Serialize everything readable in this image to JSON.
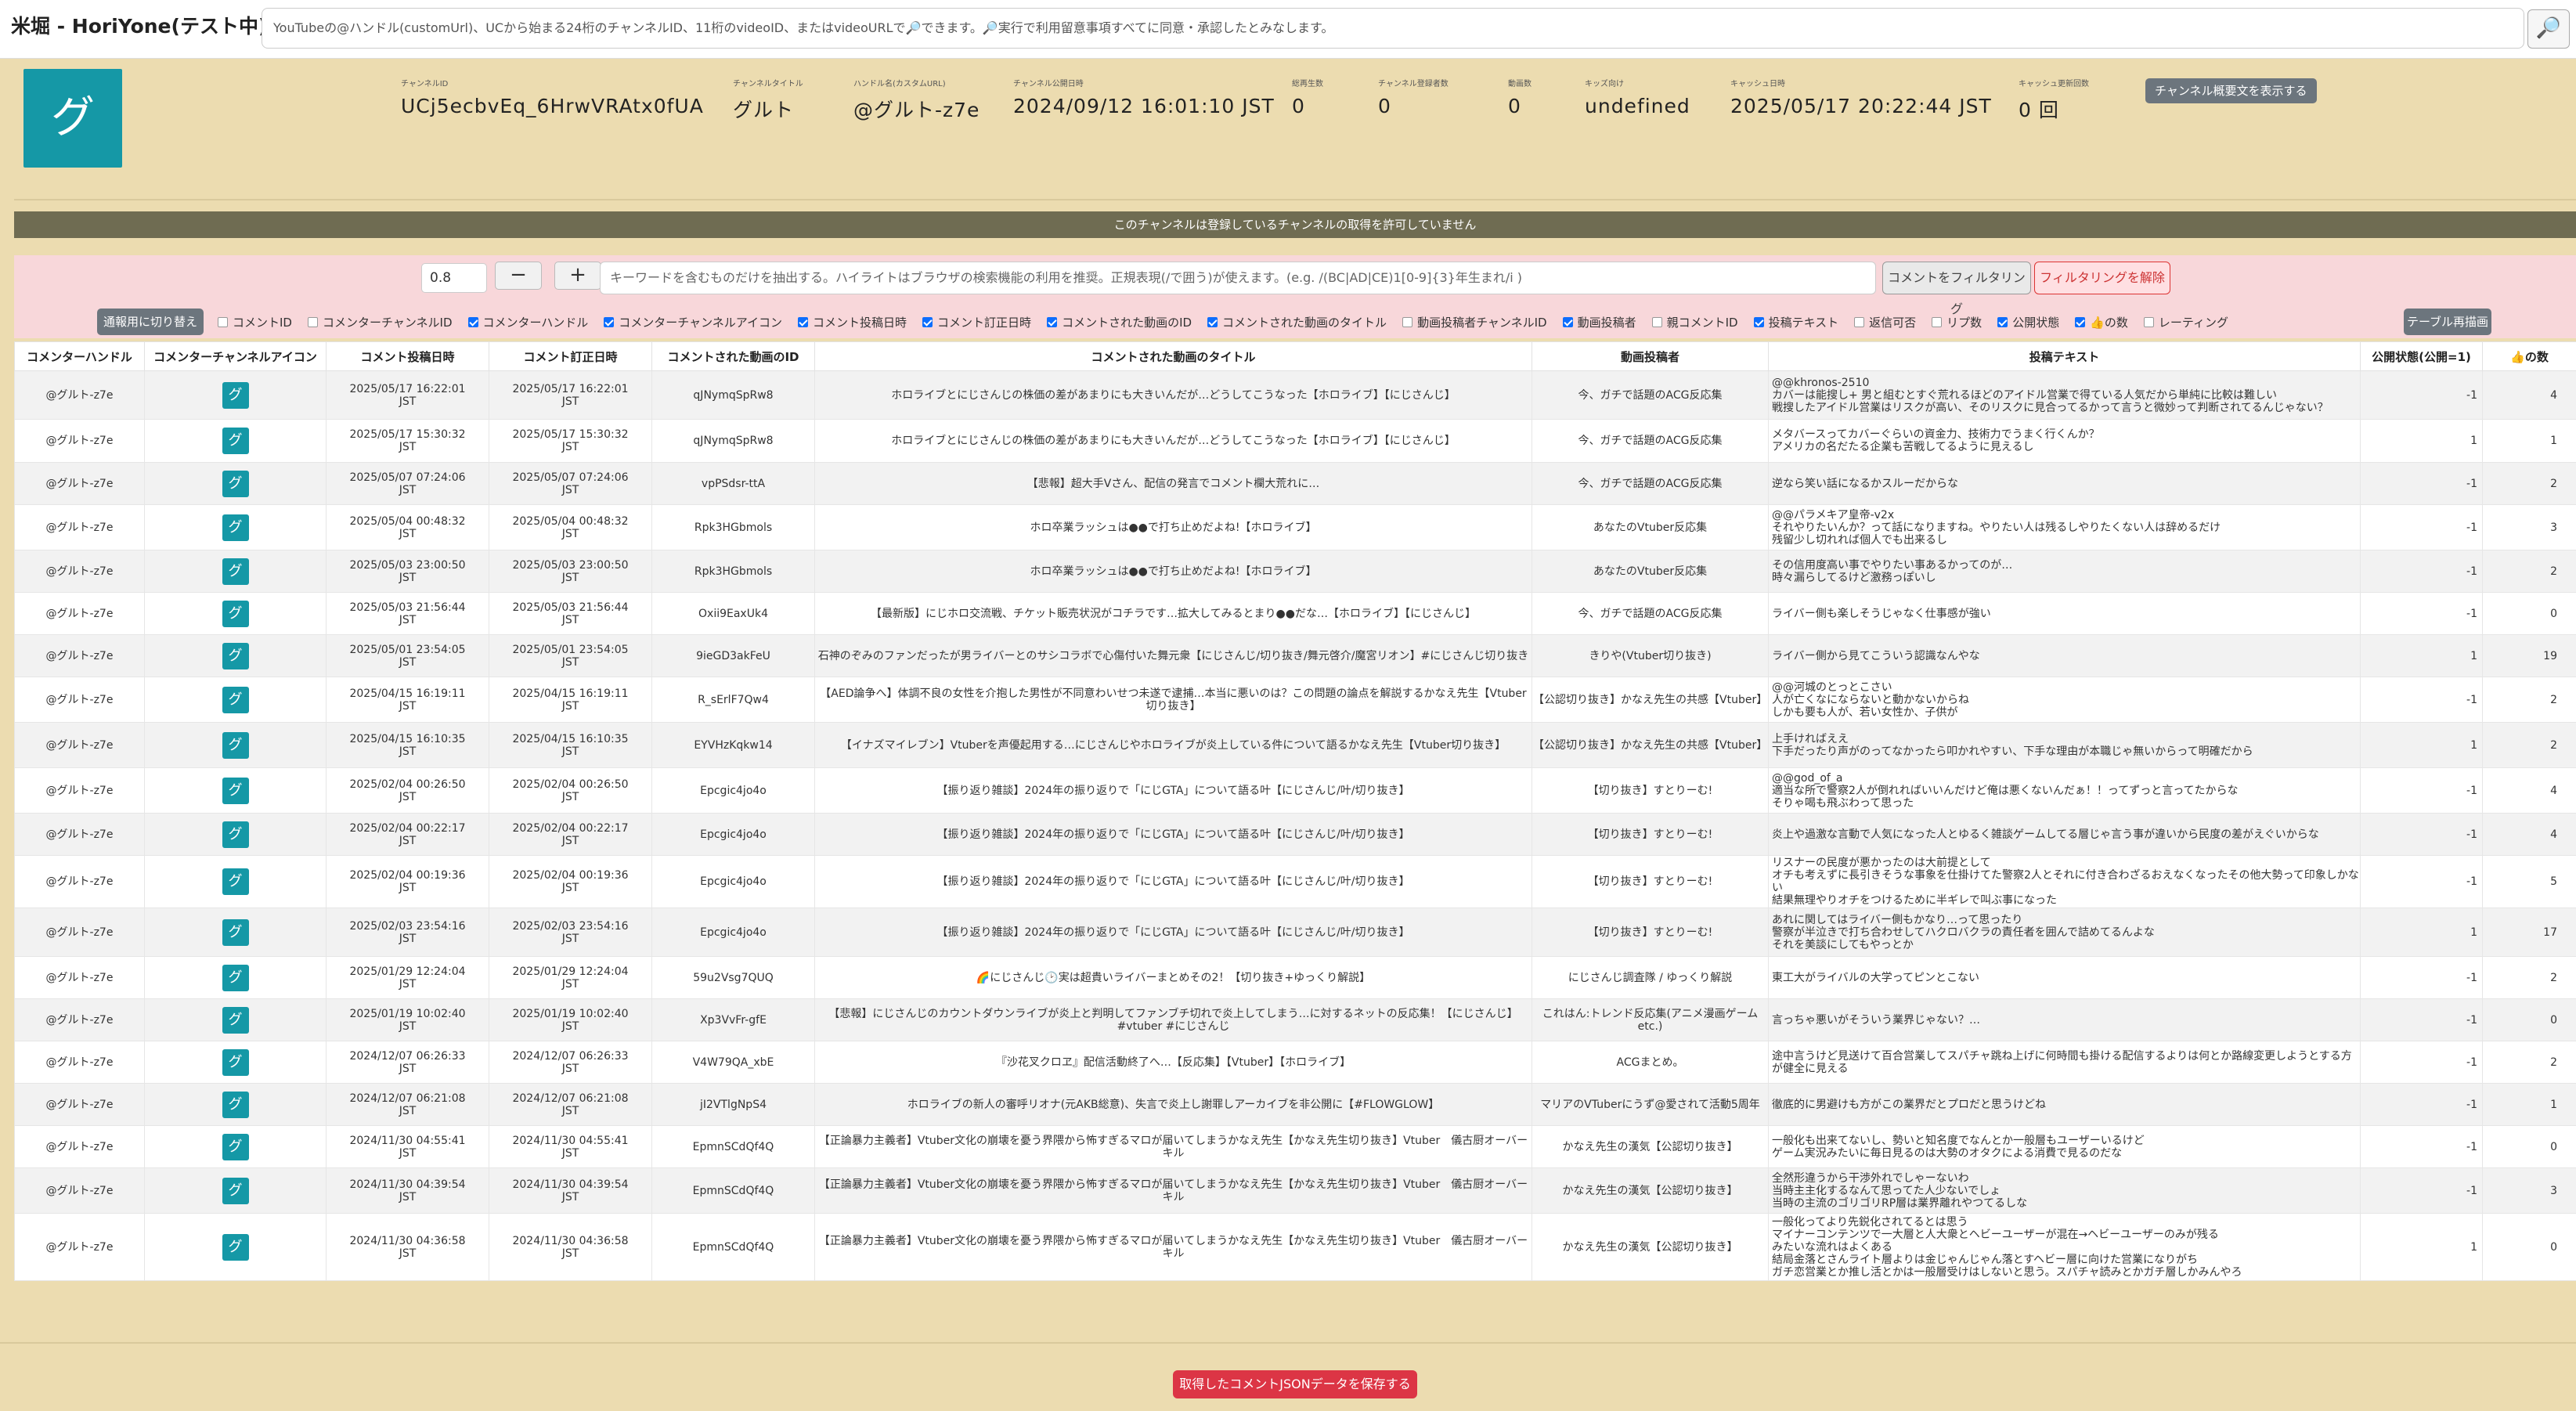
{
  "app": {
    "title": "米堀 - HoriYone(テスト中)"
  },
  "search": {
    "placeholder": "YouTubeの@ハンドル(customUrl)、UCから始まる24桁のチャンネルID、11桁のvideoID、またはvideoURLで🔎できます。🔎実行で利用留意事項すべてに同意・承認したとみなします。",
    "button_icon": "🔎"
  },
  "channel": {
    "icon_char": "グ",
    "fields": [
      {
        "label": "チャンネルID",
        "value": "UCj5ecbvEq_6HrwVRAtx0fUA"
      },
      {
        "label": "チャンネルタイトル",
        "value": "グルト"
      },
      {
        "label": "ハンドル名(カスタムURL)",
        "value": "@グルト-z7e"
      },
      {
        "label": "チャンネル公開日時",
        "value": "2024/09/12 16:01:10 JST"
      },
      {
        "label": "総再生数",
        "value": "0"
      },
      {
        "label": "チャンネル登録者数",
        "value": "0"
      },
      {
        "label": "動画数",
        "value": "0"
      },
      {
        "label": "キッズ向け",
        "value": "undefined"
      },
      {
        "label": "キャッシュ日時",
        "value": "2025/05/17 20:22:44 JST"
      },
      {
        "label": "キャッシュ更新回数",
        "value": "0 回"
      }
    ],
    "desc_button": "チャンネル概要文を表示する"
  },
  "banner": "このチャンネルは登録しているチャンネルの取得を許可していません",
  "filter": {
    "threshold": "0.8",
    "minus": "−",
    "plus": "+",
    "keyword_placeholder": "キーワードを含むものだけを抽出する。ハイライトはブラウザの検索機能の利用を推奨。正規表現(/で囲う)が使えます。(e.g. /(BC|AD|CE)1[0-9]{3}年生まれ/i )",
    "filter_button": "コメントをフィルタリング",
    "unfilter_button": "フィルタリングを解除",
    "switch_button": "通報用に切り替え",
    "redraw_button": "テーブル再描画",
    "columns": [
      {
        "label": "コメントID",
        "checked": false
      },
      {
        "label": "コメンターチャンネルID",
        "checked": false
      },
      {
        "label": "コメンターハンドル",
        "checked": true
      },
      {
        "label": "コメンターチャンネルアイコン",
        "checked": true
      },
      {
        "label": "コメント投稿日時",
        "checked": true
      },
      {
        "label": "コメント訂正日時",
        "checked": true
      },
      {
        "label": "コメントされた動画のID",
        "checked": true
      },
      {
        "label": "コメントされた動画のタイトル",
        "checked": true
      },
      {
        "label": "動画投稿者チャンネルID",
        "checked": false
      },
      {
        "label": "動画投稿者",
        "checked": true
      },
      {
        "label": "親コメントID",
        "checked": false
      },
      {
        "label": "投稿テキスト",
        "checked": true
      },
      {
        "label": "返信可否",
        "checked": false
      },
      {
        "label": "リプ数",
        "checked": false
      },
      {
        "label": "公開状態",
        "checked": true
      },
      {
        "label": "👍の数",
        "checked": true
      },
      {
        "label": "レーティング",
        "checked": false
      }
    ]
  },
  "table": {
    "headers": [
      "コメンターハンドル",
      "コメンターチャンネルアイコン",
      "コメント投稿日時",
      "コメント訂正日時",
      "コメントされた動画のID",
      "コメントされた動画のタイトル",
      "動画投稿者",
      "投稿テキスト",
      "公開状態(公開=1)",
      "👍の数"
    ],
    "rows": [
      {
        "handle": "@グルト-z7e",
        "icon": "グ",
        "posted": "2025/05/17 16:22:01\nJST",
        "edited": "2025/05/17 16:22:01\nJST",
        "vid": "qJNymqSpRw8",
        "title": "ホロライブとにじさんじの株価の差があまりにも大きいんだが…どうしてこうなった【ホロライブ】【にじさんじ】",
        "uploader": "今、ガチで話題のACG反応集",
        "text": "@@khronos-2510\nカバーは能搜し+ 男と組むとすぐ荒れるほどのアイドル営業で得ている人気だから単純に比較は難しい\n戦搜したアイドル営業はリスクが高い、そのリスクに見合ってるかって言うと微妙って判断されてるんじゃない？",
        "status": "-1",
        "likes": "4",
        "h": 62
      },
      {
        "handle": "@グルト-z7e",
        "icon": "グ",
        "posted": "2025/05/17 15:30:32\nJST",
        "edited": "2025/05/17 15:30:32\nJST",
        "vid": "qJNymqSpRw8",
        "title": "ホロライブとにじさんじの株価の差があまりにも大きいんだが…どうしてこうなった【ホロライブ】【にじさんじ】",
        "uploader": "今、ガチで話題のACG反応集",
        "text": "メタバースってカバーぐらいの資金力、技術力でうまく行くんか？\nアメリカの名だたる企業も苦戦してるように見えるし",
        "status": "1",
        "likes": "1",
        "h": 55
      },
      {
        "handle": "@グルト-z7e",
        "icon": "グ",
        "posted": "2025/05/07 07:24:06\nJST",
        "edited": "2025/05/07 07:24:06\nJST",
        "vid": "vpPSdsr-ttA",
        "title": "【悲報】超大手Vさん、配信の発言でコメント欄大荒れに…",
        "uploader": "今、ガチで話題のACG反応集",
        "text": "逆なら笑い話になるかスルーだからな",
        "status": "-1",
        "likes": "2",
        "h": 54
      },
      {
        "handle": "@グルト-z7e",
        "icon": "グ",
        "posted": "2025/05/04 00:48:32\nJST",
        "edited": "2025/05/04 00:48:32\nJST",
        "vid": "Rpk3HGbmols",
        "title": "ホロ卒業ラッシュは●●で打ち止めだよね!【ホロライブ】",
        "uploader": "あなたのVtuber反応集",
        "text": "@@パラメキア皇帝-v2x\nそれやりたいんか？って話になりますね。やりたい人は残るしやりたくない人は辞めるだけ\n残留少し切れれば個人でも出来るし",
        "status": "-1",
        "likes": "3",
        "h": 58
      },
      {
        "handle": "@グルト-z7e",
        "icon": "グ",
        "posted": "2025/05/03 23:00:50\nJST",
        "edited": "2025/05/03 23:00:50\nJST",
        "vid": "Rpk3HGbmols",
        "title": "ホロ卒業ラッシュは●●で打ち止めだよね!【ホロライブ】",
        "uploader": "あなたのVtuber反応集",
        "text": "その信用度高い事でやりたい事あるかってのが…\n時々漏らしてるけど激務っぽいし",
        "status": "-1",
        "likes": "2",
        "h": 54
      },
      {
        "handle": "@グルト-z7e",
        "icon": "グ",
        "posted": "2025/05/03 21:56:44\nJST",
        "edited": "2025/05/03 21:56:44\nJST",
        "vid": "Oxii9EaxUk4",
        "title": "【最新版】にじホロ交流戦、チケット販売状況がコチラです…拡大してみるとまり●●だな…【ホロライブ】【にじさんじ】",
        "uploader": "今、ガチで話題のACG反応集",
        "text": "ライバー側も楽しそうじゃなく仕事感が強い",
        "status": "-1",
        "likes": "0",
        "h": 54
      },
      {
        "handle": "@グルト-z7e",
        "icon": "グ",
        "posted": "2025/05/01 23:54:05\nJST",
        "edited": "2025/05/01 23:54:05\nJST",
        "vid": "9ieGD3akFeU",
        "title": "石神のぞみのファンだったが男ライバーとのサシコラボで心傷付いた舞元衆【にじさんじ/切り抜き/舞元啓介/魔宮リオン】#にじさんじ切り抜き",
        "uploader": "きりや(Vtuber切り抜き)",
        "text": "ライバー側から見てこういう認識なんやな",
        "status": "1",
        "likes": "19",
        "h": 54
      },
      {
        "handle": "@グルト-z7e",
        "icon": "グ",
        "posted": "2025/04/15 16:19:11\nJST",
        "edited": "2025/04/15 16:19:11\nJST",
        "vid": "R_sErlF7Qw4",
        "title": "【AED論争へ】体調不良の女性を介抱した男性が不同意わいせつ未遂で逮捕…本当に悪いのは？この問題の論点を解説するかなえ先生【Vtuber切り抜き】",
        "uploader": "【公認切り抜き】かなえ先生の共感【Vtuber】",
        "text": "@@河城のとっとこさい\n人が亡くなにならないと動かないからね\nしかも要も人が、若い女性か、子供が",
        "status": "-1",
        "likes": "2",
        "h": 58
      },
      {
        "handle": "@グルト-z7e",
        "icon": "グ",
        "posted": "2025/04/15 16:10:35\nJST",
        "edited": "2025/04/15 16:10:35\nJST",
        "vid": "EYVHzKqkw14",
        "title": "【イナズマイレブン】Vtuberを声優起用する…にじさんじやホロライブが炎上している件について語るかなえ先生【Vtuber切り抜き】",
        "uploader": "【公認切り抜き】かなえ先生の共感【Vtuber】",
        "text": "上手ければええ\n下手だったり声がのってなかったら叩かれやすい、下手な理由が本職じゃ無いからって明確だから",
        "status": "1",
        "likes": "2",
        "h": 58
      },
      {
        "handle": "@グルト-z7e",
        "icon": "グ",
        "posted": "2025/02/04 00:26:50\nJST",
        "edited": "2025/02/04 00:26:50\nJST",
        "vid": "Epcgic4jo4o",
        "title": "【振り返り雑談】2024年の振り返りで「にじGTA」について語る叶【にじさんじ/叶/切り抜き】",
        "uploader": "【切り抜き】すとりーむ!",
        "text": "@@god_of_a\n適当な所で警察2人が倒れればいいんだけど俺は悪くないんだぁ！！ってずっと言ってたからな\nそりゃ喝も飛ぶわって思った",
        "status": "-1",
        "likes": "4",
        "h": 58
      },
      {
        "handle": "@グルト-z7e",
        "icon": "グ",
        "posted": "2025/02/04 00:22:17\nJST",
        "edited": "2025/02/04 00:22:17\nJST",
        "vid": "Epcgic4jo4o",
        "title": "【振り返り雑談】2024年の振り返りで「にじGTA」について語る叶【にじさんじ/叶/切り抜き】",
        "uploader": "【切り抜き】すとりーむ!",
        "text": "炎上や過激な言動で人気になった人とゆるく雑談ゲームしてる層じゃ言う事が違いから民度の差がえぐいからな",
        "status": "-1",
        "likes": "4",
        "h": 54
      },
      {
        "handle": "@グルト-z7e",
        "icon": "グ",
        "posted": "2025/02/04 00:19:36\nJST",
        "edited": "2025/02/04 00:19:36\nJST",
        "vid": "Epcgic4jo4o",
        "title": "【振り返り雑談】2024年の振り返りで「にじGTA」について語る叶【にじさんじ/叶/切り抜き】",
        "uploader": "【切り抜き】すとりーむ!",
        "text": "リスナーの民度が悪かったのは大前提として\nオチも考えずに長引きそうな事象を仕掛けてた警察2人とそれに付き合わざるおえなくなったその他大勢って印象しかない\n結果無理やりオチをつけるために半ギレで叫ぶ事になった",
        "status": "-1",
        "likes": "5",
        "h": 58
      },
      {
        "handle": "@グルト-z7e",
        "icon": "グ",
        "posted": "2025/02/03 23:54:16\nJST",
        "edited": "2025/02/03 23:54:16\nJST",
        "vid": "Epcgic4jo4o",
        "title": "【振り返り雑談】2024年の振り返りで「にじGTA」について語る叶【にじさんじ/叶/切り抜き】",
        "uploader": "【切り抜き】すとりーむ!",
        "text": "あれに関してはライバー側もかなり…って思ったり\n警察が半泣きで打ち合わせしてハクロバクラの責任者を囲んで詰めてるんよな\nそれを美談にしてもやっとか",
        "status": "1",
        "likes": "17",
        "h": 62
      },
      {
        "handle": "@グルト-z7e",
        "icon": "グ",
        "posted": "2025/01/29 12:24:04\nJST",
        "edited": "2025/01/29 12:24:04\nJST",
        "vid": "59u2Vsg7QUQ",
        "title": "🌈にじさんじ🕑実は超貴いライバーまとめその2！【切り抜き+ゆっくり解説】",
        "uploader": "にじさんじ調査隊 / ゆっくり解説",
        "text": "東工大がライバルの大学ってピンとこない",
        "status": "-1",
        "likes": "2",
        "h": 54
      },
      {
        "handle": "@グルト-z7e",
        "icon": "グ",
        "posted": "2025/01/19 10:02:40\nJST",
        "edited": "2025/01/19 10:02:40\nJST",
        "vid": "Xp3VvFr-gfE",
        "title": "【悲報】にじさんじのカウントダウンライブが炎上と判明してファンブチ切れで炎上してしまう…に対するネットの反応集！【にじさんじ】#vtuber #にじさんじ",
        "uploader": "これはん:トレンド反応集(アニメ漫画ゲームetc.)",
        "text": "言っちゃ悪いがそういう業界じゃない？…",
        "status": "-1",
        "likes": "0",
        "h": 54
      },
      {
        "handle": "@グルト-z7e",
        "icon": "グ",
        "posted": "2024/12/07 06:26:33\nJST",
        "edited": "2024/12/07 06:26:33\nJST",
        "vid": "V4W79QA_xbE",
        "title": "『沙花叉クロヱ』配信活動終了へ…【反応集】【Vtuber】【ホロライブ】",
        "uploader": "ACGまとめ。",
        "text": "途中言うけど見送けて百合営業してスパチャ跳ね上げに何時間も掛ける配信するよりは何とか路線変更しようとする方が健全に見える",
        "status": "-1",
        "likes": "2",
        "h": 54
      },
      {
        "handle": "@グルト-z7e",
        "icon": "グ",
        "posted": "2024/12/07 06:21:08\nJST",
        "edited": "2024/12/07 06:21:08\nJST",
        "vid": "jI2VTlgNpS4",
        "title": "ホロライブの新人の審呼リオナ(元AKB総意)、失言で炎上し謝罪しアーカイブを非公開に【#FLOWGLOW】",
        "uploader": "マリアのVTuberにうず@愛されて活動5周年",
        "text": "徹底的に男避けも方がこの業界だとプロだと思うけどね",
        "status": "-1",
        "likes": "1",
        "h": 54
      },
      {
        "handle": "@グルト-z7e",
        "icon": "グ",
        "posted": "2024/11/30 04:55:41\nJST",
        "edited": "2024/11/30 04:55:41\nJST",
        "vid": "EpmnSCdQf4Q",
        "title": "【正論暴力主義者】Vtuber文化の崩壊を憂う界隈から怖すぎるマロが届いてしまうかなえ先生【かなえ先生切り抜き】Vtuber　儀古厨オーバーキル",
        "uploader": "かなえ先生の漢気【公認切り抜き】",
        "text": "一般化も出来てないし、勢いと知名度でなんとか一般層もユーザーいるけど\nゲーム実況みたいに毎日見るのは大勢のオタクによる消費で見るのだな",
        "status": "-1",
        "likes": "0",
        "h": 54
      },
      {
        "handle": "@グルト-z7e",
        "icon": "グ",
        "posted": "2024/11/30 04:39:54\nJST",
        "edited": "2024/11/30 04:39:54\nJST",
        "vid": "EpmnSCdQf4Q",
        "title": "【正論暴力主義者】Vtuber文化の崩壊を憂う界隈から怖すぎるマロが届いてしまうかなえ先生【かなえ先生切り抜き】Vtuber　儀古厨オーバーキル",
        "uploader": "かなえ先生の漢気【公認切り抜き】",
        "text": "全然形違うから干渉外れでしゃーないわ\n当時主主化するなんて思ってた人少ないでしょ\n当時の主流のゴリゴリRP層は業界離れやつてるしな",
        "status": "-1",
        "likes": "3",
        "h": 58
      },
      {
        "handle": "@グルト-z7e",
        "icon": "グ",
        "posted": "2024/11/30 04:36:58\nJST",
        "edited": "2024/11/30 04:36:58\nJST",
        "vid": "EpmnSCdQf4Q",
        "title": "【正論暴力主義者】Vtuber文化の崩壊を憂う界隈から怖すぎるマロが届いてしまうかなえ先生【かなえ先生切り抜き】Vtuber　儀古厨オーバーキル",
        "uploader": "かなえ先生の漢気【公認切り抜き】",
        "text": "一般化ってより先鋭化されてるとは思う\nマイナーコンテンツで一大層と人大衆とヘビーユーザーが混在→ヘビーユーザーのみが残る\nみたいな流れはよくある\n結局金落とさんライト層よりは金じゃんじゃん落とすヘビー層に向けた営業になりがち\nガチ恋営業とか推し活とかは一般層受けはしないと思う。スパチャ読みとかガチ層しかみんやろ",
        "status": "1",
        "likes": "0",
        "h": 86
      }
    ]
  },
  "footer": {
    "save_button": "取得したコメントJSONデータを保存する"
  }
}
